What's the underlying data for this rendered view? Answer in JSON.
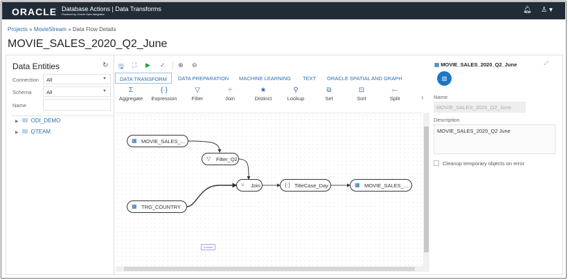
{
  "header": {
    "logo": "ORACLE",
    "app_title": "Database Actions | Data Transforms",
    "subtitle": "Powered by Oracle Data Integrator",
    "bell_icon": "bell-icon",
    "user_icon": "user-icon"
  },
  "breadcrumb": {
    "items": [
      "Projects",
      "MovieStream",
      "Data Flow Details"
    ],
    "sep": "»"
  },
  "page_title": "MOVIE_SALES_2020_Q2_June",
  "left_panel": {
    "title": "Data Entities",
    "connection_label": "Connection",
    "connection_value": "All",
    "schema_label": "Schema",
    "schema_value": "All",
    "name_label": "Name",
    "name_value": "",
    "tree": [
      "ODI_DEMO",
      "QTEAM"
    ]
  },
  "toolbar": {
    "icons": [
      "save-icon",
      "auto-layout-icon",
      "run-icon",
      "validate-icon",
      "zoom-in-icon",
      "zoom-out-icon"
    ]
  },
  "tabs": [
    "DATA TRANSFORM",
    "DATA PREPARATION",
    "MACHINE LEARNING",
    "TEXT",
    "ORACLE SPATIAL AND GRAPH"
  ],
  "active_tab": "DATA TRANSFORM",
  "tools": [
    {
      "label": "Aggregate",
      "icon": "Σ"
    },
    {
      "label": "Expression",
      "icon": "{·}"
    },
    {
      "label": "Filter",
      "icon": "▽"
    },
    {
      "label": "Join",
      "icon": "⑂"
    },
    {
      "label": "Distinct",
      "icon": "★"
    },
    {
      "label": "Lookup",
      "icon": "⚲"
    },
    {
      "label": "Set",
      "icon": "⧉"
    },
    {
      "label": "Sort",
      "icon": "⊡"
    },
    {
      "label": "Split",
      "icon": "⤚"
    }
  ],
  "canvas": {
    "nodes": {
      "source1": "MOVIE_SALES_...",
      "filter": "Filter_Q2",
      "join": "Join",
      "expression": "TitleCase_Day",
      "target": "MOVIE_SALES_...",
      "source2": "TRG_COUNTRY"
    },
    "edge_label": "Transfer"
  },
  "right_panel": {
    "title": "MOVIE_SALES_2020_Q2_June",
    "name_label": "Name",
    "name_value": "MOVIE_SALES_2020_Q2_June",
    "description_label": "Description",
    "description_value": "MOVIE_SALES_2020_Q2 June",
    "cleanup_label": "Cleanup temporary objects on error",
    "cleanup_checked": false
  },
  "colors": {
    "header_bg": "#222c37",
    "accent": "#2a6fb0",
    "primary_button": "#1d76c4"
  }
}
